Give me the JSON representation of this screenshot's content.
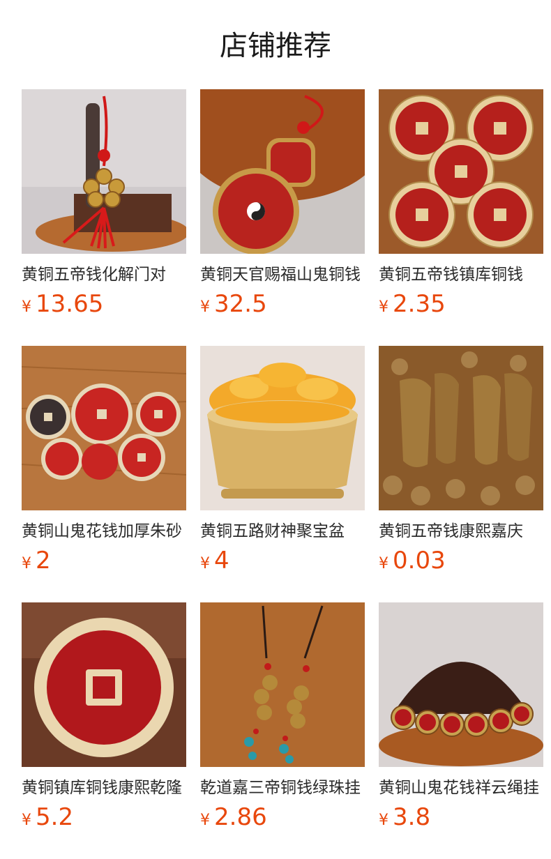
{
  "header": {
    "title": "店铺推荐"
  },
  "currency_symbol": "¥",
  "colors": {
    "price": "#e8470c",
    "title": "#1a1a1a",
    "name": "#2a2a2a"
  },
  "products": [
    {
      "name": "黄铜五帝钱化解门对",
      "price": "13.65",
      "image": "five-emperor-coin-tassel-pendant"
    },
    {
      "name": "黄铜天官赐福山鬼铜钱",
      "price": "32.5",
      "image": "gourd-blessing-pendant"
    },
    {
      "name": "黄铜五帝钱镇库铜钱",
      "price": "2.35",
      "image": "five-red-brass-coins"
    },
    {
      "name": "黄铜山鬼花钱加厚朱砂",
      "price": "2",
      "image": "assorted-charm-coins"
    },
    {
      "name": "黄铜五路财神聚宝盆",
      "price": "4",
      "image": "treasure-bowl-with-ingots"
    },
    {
      "name": "黄铜五帝钱康熙嘉庆",
      "price": "0.03",
      "image": "stacked-ancient-coins"
    },
    {
      "name": "黄铜镇库铜钱康熙乾隆",
      "price": "5.2",
      "image": "large-red-yongzheng-coin"
    },
    {
      "name": "乾道嘉三帝铜钱绿珠挂",
      "price": "2.86",
      "image": "three-coin-bead-hangers"
    },
    {
      "name": "黄铜山鬼花钱祥云绳挂",
      "price": "3.8",
      "image": "coin-pendants-on-cords"
    }
  ]
}
